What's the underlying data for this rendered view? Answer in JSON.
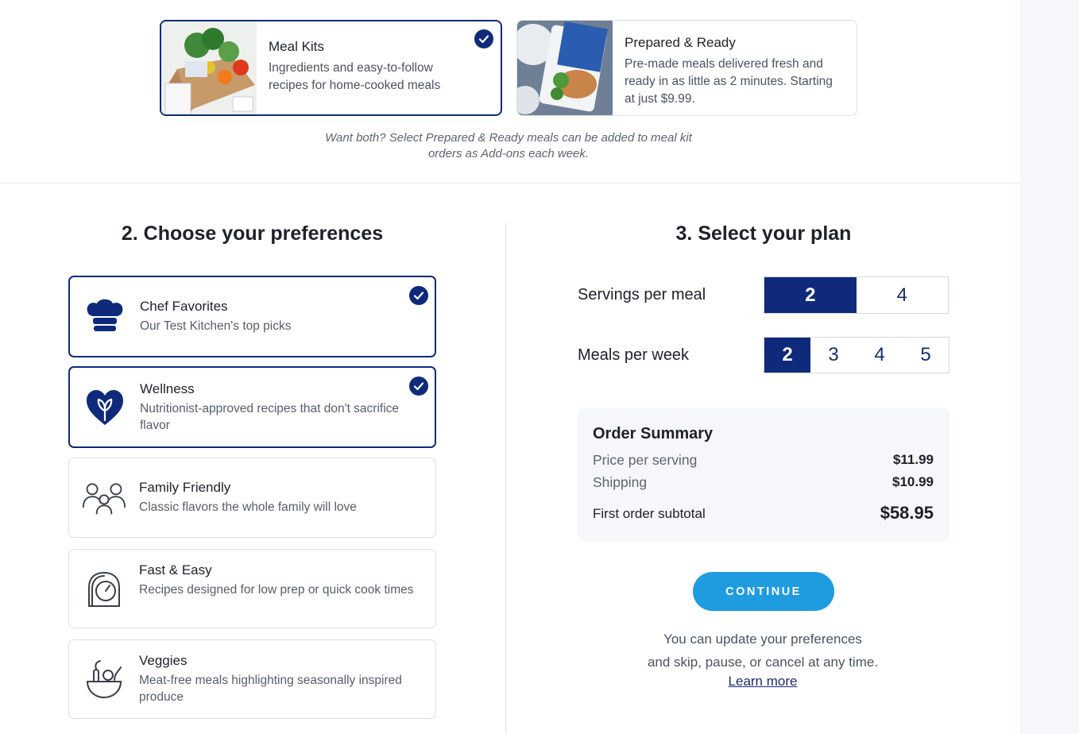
{
  "plan_types": [
    {
      "title": "Meal Kits",
      "description": "Ingredients and easy-to-follow recipes for home-cooked meals",
      "selected": true
    },
    {
      "title": "Prepared & Ready",
      "description": "Pre-made meals delivered fresh and ready in as little as 2 minutes. Starting at just $9.99.",
      "selected": false
    }
  ],
  "note": "Want both? Select Prepared & Ready meals can be added to meal kit orders as Add-ons each week.",
  "preferences": {
    "title": "2. Choose your preferences",
    "items": [
      {
        "title": "Chef Favorites",
        "description": "Our Test Kitchen's top picks",
        "icon": "chef-hat-icon",
        "selected": true
      },
      {
        "title": "Wellness",
        "description": "Nutritionist-approved recipes that don't sacrifice flavor",
        "icon": "heart-leaf-icon",
        "selected": true
      },
      {
        "title": "Family Friendly",
        "description": "Classic flavors the whole family will love",
        "icon": "family-icon",
        "selected": false
      },
      {
        "title": "Fast & Easy",
        "description": "Recipes designed for low prep or quick cook times",
        "icon": "timer-icon",
        "selected": false
      },
      {
        "title": "Veggies",
        "description": "Meat-free meals highlighting seasonally inspired produce",
        "icon": "veggie-bowl-icon",
        "selected": false
      }
    ]
  },
  "plan": {
    "title": "3. Select your plan",
    "servings_label": "Servings per meal",
    "servings_options": [
      "2",
      "4"
    ],
    "servings_selected": "2",
    "meals_label": "Meals per week",
    "meals_options": [
      "2",
      "3",
      "4",
      "5"
    ],
    "meals_selected": "2"
  },
  "summary": {
    "title": "Order Summary",
    "price_label": "Price per serving",
    "price_value": "$11.99",
    "shipping_label": "Shipping",
    "shipping_value": "$10.99",
    "subtotal_label": "First order subtotal",
    "subtotal_value": "$58.95"
  },
  "continue_label": "CONTINUE",
  "info_line1": "You can update your preferences",
  "info_line2": "and skip, pause, or cancel at any time.",
  "learn_more": "Learn more",
  "colors": {
    "navy": "#0f2a7a",
    "accent": "#1f9be0"
  }
}
